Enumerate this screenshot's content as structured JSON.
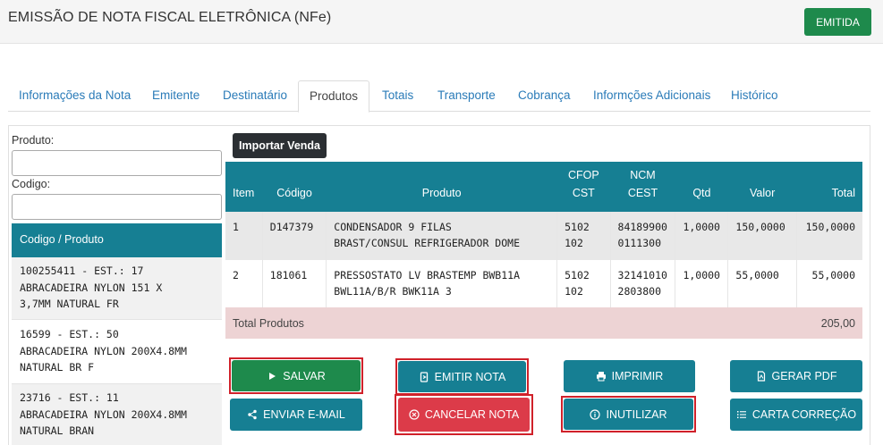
{
  "header": {
    "title": "EMISSÃO DE NOTA FISCAL ELETRÔNICA (NFe)",
    "status_button": "EMITIDA"
  },
  "tabs": [
    {
      "label": "Informações da Nota"
    },
    {
      "label": "Emitente"
    },
    {
      "label": "Destinatário"
    },
    {
      "label": "Produtos",
      "active": true
    },
    {
      "label": "Totais"
    },
    {
      "label": "Transporte"
    },
    {
      "label": "Cobrança"
    },
    {
      "label": "Informções Adicionais"
    },
    {
      "label": "Histórico"
    }
  ],
  "sidebar": {
    "produto_label": "Produto:",
    "codigo_label": "Codigo:",
    "list_header": "Codigo / Produto",
    "items": [
      {
        "line1": "100255411 - EST.: 17",
        "line2": "ABRACADEIRA NYLON 151 X",
        "line3": "3,7MM NATURAL FR"
      },
      {
        "line1": "16599 - EST.: 50",
        "line2": "ABRACADEIRA NYLON 200X4.8MM",
        "line3": "NATURAL BR F"
      },
      {
        "line1": "23716 - EST.: 11",
        "line2": "ABRACADEIRA NYLON 200X4.8MM",
        "line3": "NATURAL BRAN"
      }
    ]
  },
  "import_button": "Importar Venda",
  "table": {
    "headers": {
      "item": "Item",
      "codigo": "Código",
      "produto": "Produto",
      "cfop": "CFOP",
      "cst": "CST",
      "ncm": "NCM",
      "cest": "CEST",
      "qtd": "Qtd",
      "valor": "Valor",
      "total": "Total"
    },
    "rows": [
      {
        "item": "1",
        "codigo": "D147379",
        "produto1": "CONDENSADOR 9 FILAS",
        "produto2": "BRAST/CONSUL REFRIGERADOR DOME",
        "cfop": "5102",
        "cst": "102",
        "ncm": "84189900",
        "cest": "0111300",
        "qtd": "1,0000",
        "valor": "150,0000",
        "total": "150,0000"
      },
      {
        "item": "2",
        "codigo": "181061",
        "produto1": "PRESSOSTATO LV BRASTEMP BWB11A",
        "produto2": "BWL11A/B/R BWK11A 3",
        "cfop": "5102",
        "cst": "102",
        "ncm": "32141010",
        "cest": "2803800",
        "qtd": "1,0000",
        "valor": "55,0000",
        "total": "55,0000"
      }
    ],
    "total_label": "Total Produtos",
    "total_value": "205,00"
  },
  "actions": {
    "salvar": "SALVAR",
    "emitir": "EMITIR NOTA",
    "imprimir": "IMPRIMIR",
    "gerar_pdf": "GERAR PDF",
    "enviar_email": "ENVIAR E-MAIL",
    "cancelar": "CANCELAR NOTA",
    "inutilizar": "INUTILIZAR",
    "carta": "CARTA CORREÇÃO"
  },
  "colors": {
    "teal": "#167f93",
    "green": "#1e8a4c",
    "red": "#dc3b49",
    "highlight_border": "#d0212a",
    "total_row": "#edd3d4"
  }
}
